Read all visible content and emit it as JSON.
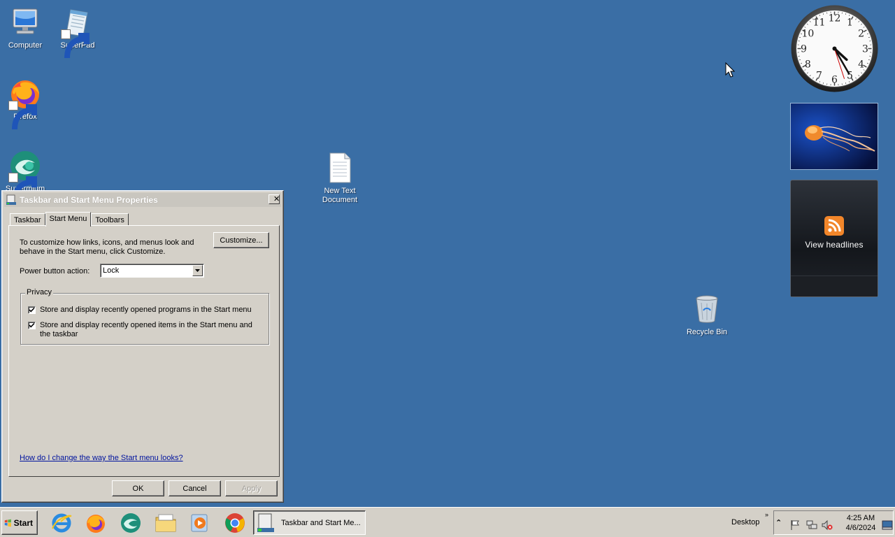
{
  "desktop": {
    "icons": [
      {
        "label": "Computer"
      },
      {
        "label": "SuperPad"
      },
      {
        "label": "Firefox"
      },
      {
        "label": "Supermium"
      },
      {
        "label": "New Text Document"
      },
      {
        "label": "Recycle Bin"
      }
    ],
    "new_text_line1": "New Text",
    "new_text_line2": "Document"
  },
  "gadgets": {
    "clock": {
      "numerals": [
        "12",
        "1",
        "2",
        "3",
        "4",
        "5",
        "6",
        "7",
        "8",
        "9",
        "10",
        "11"
      ],
      "time_hour": 4,
      "time_minute": 25,
      "time_second": 27
    },
    "feeds": {
      "label": "View headlines",
      "icon": "rss-icon"
    }
  },
  "dialog": {
    "title": "Taskbar and Start Menu Properties",
    "close_glyph": "✕",
    "tabs": [
      {
        "label": "Taskbar",
        "active": false
      },
      {
        "label": "Start Menu",
        "active": true
      },
      {
        "label": "Toolbars",
        "active": false
      }
    ],
    "description": "To customize how links, icons, and menus look and behave in the Start menu, click Customize.",
    "customize_label": "Customize...",
    "power_label": "Power button action:",
    "power_value": "Lock",
    "privacy": {
      "legend": "Privacy",
      "options": [
        {
          "label": "Store and display recently opened programs in the Start menu",
          "checked": true
        },
        {
          "label": "Store and display recently opened items in the Start menu and the taskbar",
          "checked": true
        }
      ]
    },
    "help_link": "How do I change the way the Start menu looks?",
    "ok_label": "OK",
    "cancel_label": "Cancel",
    "apply_label": "Apply"
  },
  "taskbar": {
    "start_label": "Start",
    "quick_launch": [
      "internet-explorer-icon",
      "firefox-icon",
      "supermium-icon",
      "file-explorer-icon",
      "media-player-icon",
      "chrome-icon"
    ],
    "active_task": "Taskbar and Start Me...",
    "desktop_label": "Desktop",
    "chevron": "»",
    "tray_expand": "⌃",
    "time": "4:25 AM",
    "date": "4/6/2024"
  },
  "colors": {
    "desktop": "#3a6ea5",
    "chrome": "#d4d0c8",
    "link": "#00139e"
  }
}
